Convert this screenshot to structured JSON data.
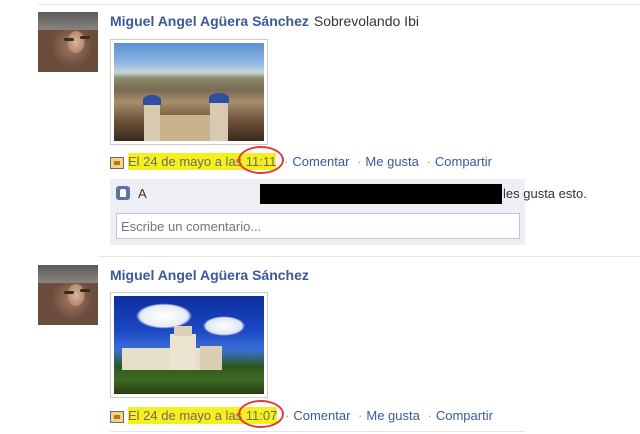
{
  "posts": [
    {
      "author": "Miguel Angel Agüera Sánchez",
      "status": "Sobrevolando Ibi",
      "date_text": "El 24 de mayo a las ",
      "time": "11:11",
      "actions": {
        "comment": "Comentar",
        "like": "Me gusta",
        "share": "Compartir"
      },
      "likes": {
        "prefix": "A",
        "suffix": "les gusta esto."
      },
      "comment_placeholder": "Escribe un comentario..."
    },
    {
      "author": "Miguel Angel Agüera Sánchez",
      "status": "",
      "date_text": "El 24 de mayo a las ",
      "time": "11:07",
      "actions": {
        "comment": "Comentar",
        "like": "Me gusta",
        "share": "Compartir"
      }
    }
  ],
  "separator": "·",
  "colors": {
    "link": "#3b5998",
    "highlight": "#f5ef1e",
    "annotation_circle": "#e03a3a"
  }
}
